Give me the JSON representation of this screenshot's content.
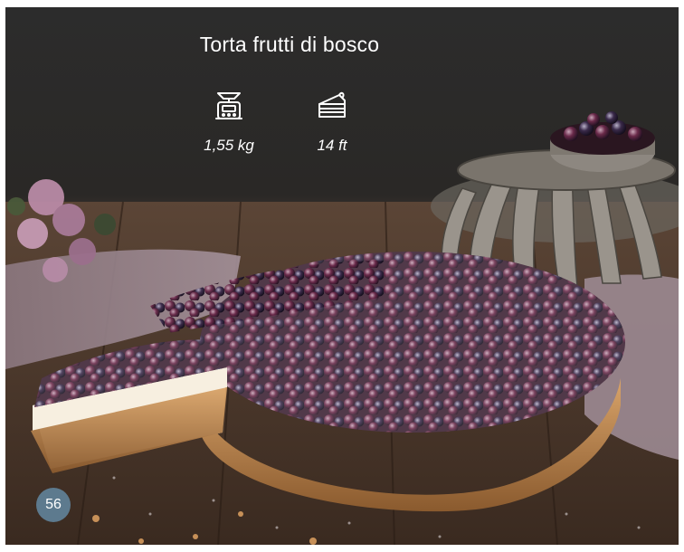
{
  "product": {
    "title": "Torta frutti di bosco",
    "weight": "1,55 kg",
    "portions": "14 ft"
  },
  "icons": {
    "weight": "kitchen-scale-icon",
    "portions": "cake-slice-icon"
  },
  "page": {
    "number": "56"
  },
  "colors": {
    "badge": "#5d7a8e",
    "text": "#ffffff",
    "background": "#2b2b2b"
  }
}
